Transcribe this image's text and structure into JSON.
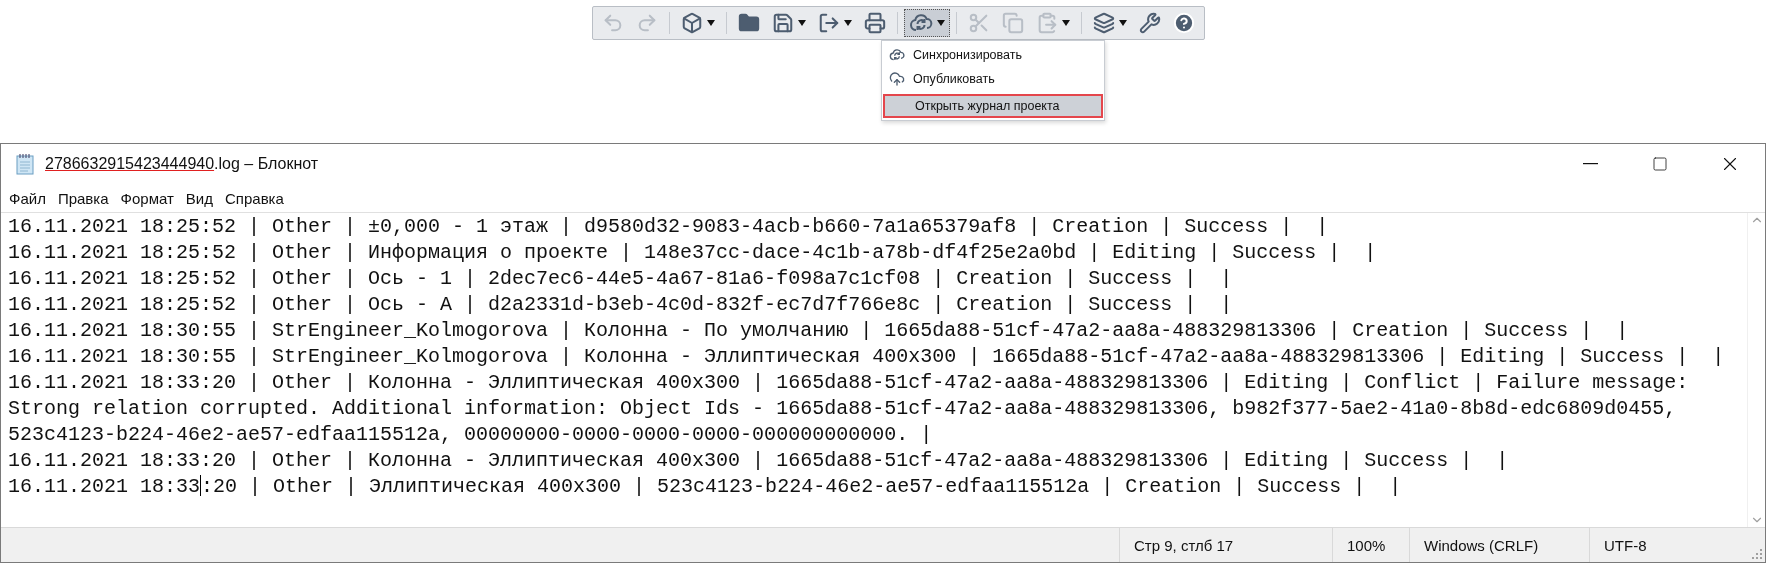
{
  "toolbar": {
    "groups": [
      [
        {
          "disabled": true,
          "pressed": false,
          "dropdown": false
        },
        {
          "disabled": true,
          "pressed": false,
          "dropdown": false
        }
      ],
      [
        {
          "disabled": false,
          "pressed": false,
          "dropdown": true
        }
      ],
      [
        {
          "disabled": false,
          "pressed": false,
          "dropdown": false
        },
        {
          "disabled": false,
          "pressed": false,
          "dropdown": true
        },
        {
          "disabled": false,
          "pressed": false,
          "dropdown": true
        },
        {
          "disabled": false,
          "pressed": false,
          "dropdown": false
        }
      ],
      [
        {
          "disabled": false,
          "pressed": true,
          "dropdown": true
        }
      ],
      [
        {
          "disabled": true,
          "pressed": false,
          "dropdown": false
        },
        {
          "disabled": true,
          "pressed": false,
          "dropdown": false
        },
        {
          "disabled": true,
          "pressed": false,
          "dropdown": true
        }
      ],
      [
        {
          "disabled": false,
          "pressed": false,
          "dropdown": true
        },
        {
          "disabled": false,
          "pressed": false,
          "dropdown": false
        },
        {
          "disabled": false,
          "pressed": false,
          "dropdown": false
        }
      ]
    ]
  },
  "dropdown_menu": {
    "items": [
      {
        "label": "Синхронизировать",
        "selected": false
      },
      {
        "label": "Опубликовать",
        "selected": false
      },
      {
        "label": "Открыть журнал проекта",
        "selected": true
      }
    ]
  },
  "window": {
    "title_underlined": "2786632915423444940",
    "title_rest": ".log – Блокнот"
  },
  "menu_bar": [
    "Файл",
    "Правка",
    "Формат",
    "Вид",
    "Справка"
  ],
  "editor": {
    "lines": [
      {
        "text": "16.11.2021 18:25:52 | Other | ±0,000 - 1 этаж | d9580d32-9083-4acb-b660-7a1a65379af8 | Creation | Success |  |"
      },
      {
        "text": "16.11.2021 18:25:52 | Other | Информация о проекте | 148e37cc-dace-4c1b-a78b-df4f25e2a0bd | Editing | Success |  |"
      },
      {
        "text": "16.11.2021 18:25:52 | Other | Ось - 1 | 2dec7ec6-44e5-4a67-81a6-f098a7c1cf08 | Creation | Success |  |"
      },
      {
        "text": "16.11.2021 18:25:52 | Other | Ось - A | d2a2331d-b3eb-4c0d-832f-ec7d7f766e8c | Creation | Success |  |"
      },
      {
        "text": "16.11.2021 18:30:55 | StrEngineer_Kolmogorova | Колонна - По умолчанию | 1665da88-51cf-47a2-aa8a-488329813306 | Creation | Success |  |"
      },
      {
        "text": "16.11.2021 18:30:55 | StrEngineer_Kolmogorova | Колонна - Эллиптическая 400x300 | 1665da88-51cf-47a2-aa8a-488329813306 | Editing | Success |  |"
      },
      {
        "text": "16.11.2021 18:33:20 | Other | Колонна - Эллиптическая 400x300 | 1665da88-51cf-47a2-aa8a-488329813306 | Editing | Conflict | Failure message:"
      },
      {
        "text": "Strong relation corrupted. Additional information: Object Ids - 1665da88-51cf-47a2-aa8a-488329813306, b982f377-5ae2-41a0-8b8d-edc6809d0455,"
      },
      {
        "text": "523c4123-b224-46e2-ae57-edfaa115512a, 00000000-0000-0000-0000-000000000000. |"
      },
      {
        "text": "16.11.2021 18:33:20 | Other | Колонна - Эллиптическая 400x300 | 1665da88-51cf-47a2-aa8a-488329813306 | Editing | Success |  |"
      },
      {
        "text": "16.11.2021 18:33",
        "text_after_caret": ":20 | Other | Эллиптическая 400x300 | 523c4123-b224-46e2-ae57-edfaa115512a | Creation | Success |  |"
      }
    ]
  },
  "status_bar": {
    "position": "Стр 9, стлб 17",
    "zoom": "100%",
    "line_endings": "Windows (CRLF)",
    "encoding": "UTF-8"
  }
}
